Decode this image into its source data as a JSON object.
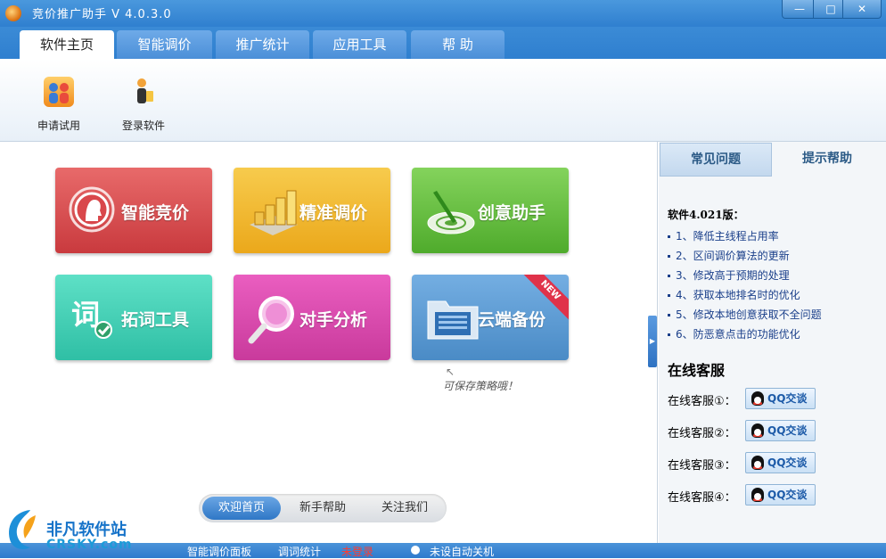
{
  "window": {
    "title": "竞价推广助手  V 4.0.3.0",
    "controls": [
      "—",
      "□",
      "✕"
    ]
  },
  "tabs": [
    {
      "label": "软件主页",
      "active": true
    },
    {
      "label": "智能调价",
      "active": false
    },
    {
      "label": "推广统计",
      "active": false
    },
    {
      "label": "应用工具",
      "active": false
    },
    {
      "label": "帮  助",
      "active": false
    }
  ],
  "toolbar": {
    "apply_trial": "申请试用",
    "login": "登录软件"
  },
  "tiles": {
    "bid": "智能竞价",
    "adjust": "精准调价",
    "creative": "创意助手",
    "words": "拓词工具",
    "analysis": "对手分析",
    "cloud": "云端备份",
    "new_badge": "NEW",
    "cloud_note": "可保存策略哦！"
  },
  "bottom_tabs": [
    {
      "label": "欢迎首页",
      "active": true
    },
    {
      "label": "新手帮助",
      "active": false
    },
    {
      "label": "关注我们",
      "active": false
    }
  ],
  "right_panel": {
    "tab_faq": "常见问题",
    "tab_tips": "提示帮助",
    "version_title": "软件4.021版：",
    "notes": [
      "1、降低主线程占用率",
      "2、区间调价算法的更新",
      "3、修改高于预期的处理",
      "4、获取本地排名时的优化",
      "5、修改本地创意获取不全问题",
      "6、防恶意点击的功能优化"
    ],
    "cs_title": "在线客服",
    "cs_items": [
      {
        "label": "在线客服①：",
        "button": "QQ交谈"
      },
      {
        "label": "在线客服②：",
        "button": "QQ交谈"
      },
      {
        "label": "在线客服③：",
        "button": "QQ交谈"
      },
      {
        "label": "在线客服④：",
        "button": "QQ交谈"
      }
    ]
  },
  "statusbar": {
    "panel": "智能调价面板",
    "stats": "调词统计",
    "login_status": "未登录",
    "auto_shutdown": "未设自动关机"
  },
  "watermark": {
    "line1": "非凡软件站",
    "line2": "CRSKY.com"
  },
  "colors": {
    "accent_blue": "#2f7fcf",
    "tile_bid": "#c93a3e",
    "tile_adjust": "#eba81b",
    "tile_creative": "#4fab2c",
    "tile_words": "#2fbfa5",
    "tile_analysis": "#c93a9c",
    "tile_cloud": "#4a8bc6",
    "login_status": "#ff3b2f"
  }
}
